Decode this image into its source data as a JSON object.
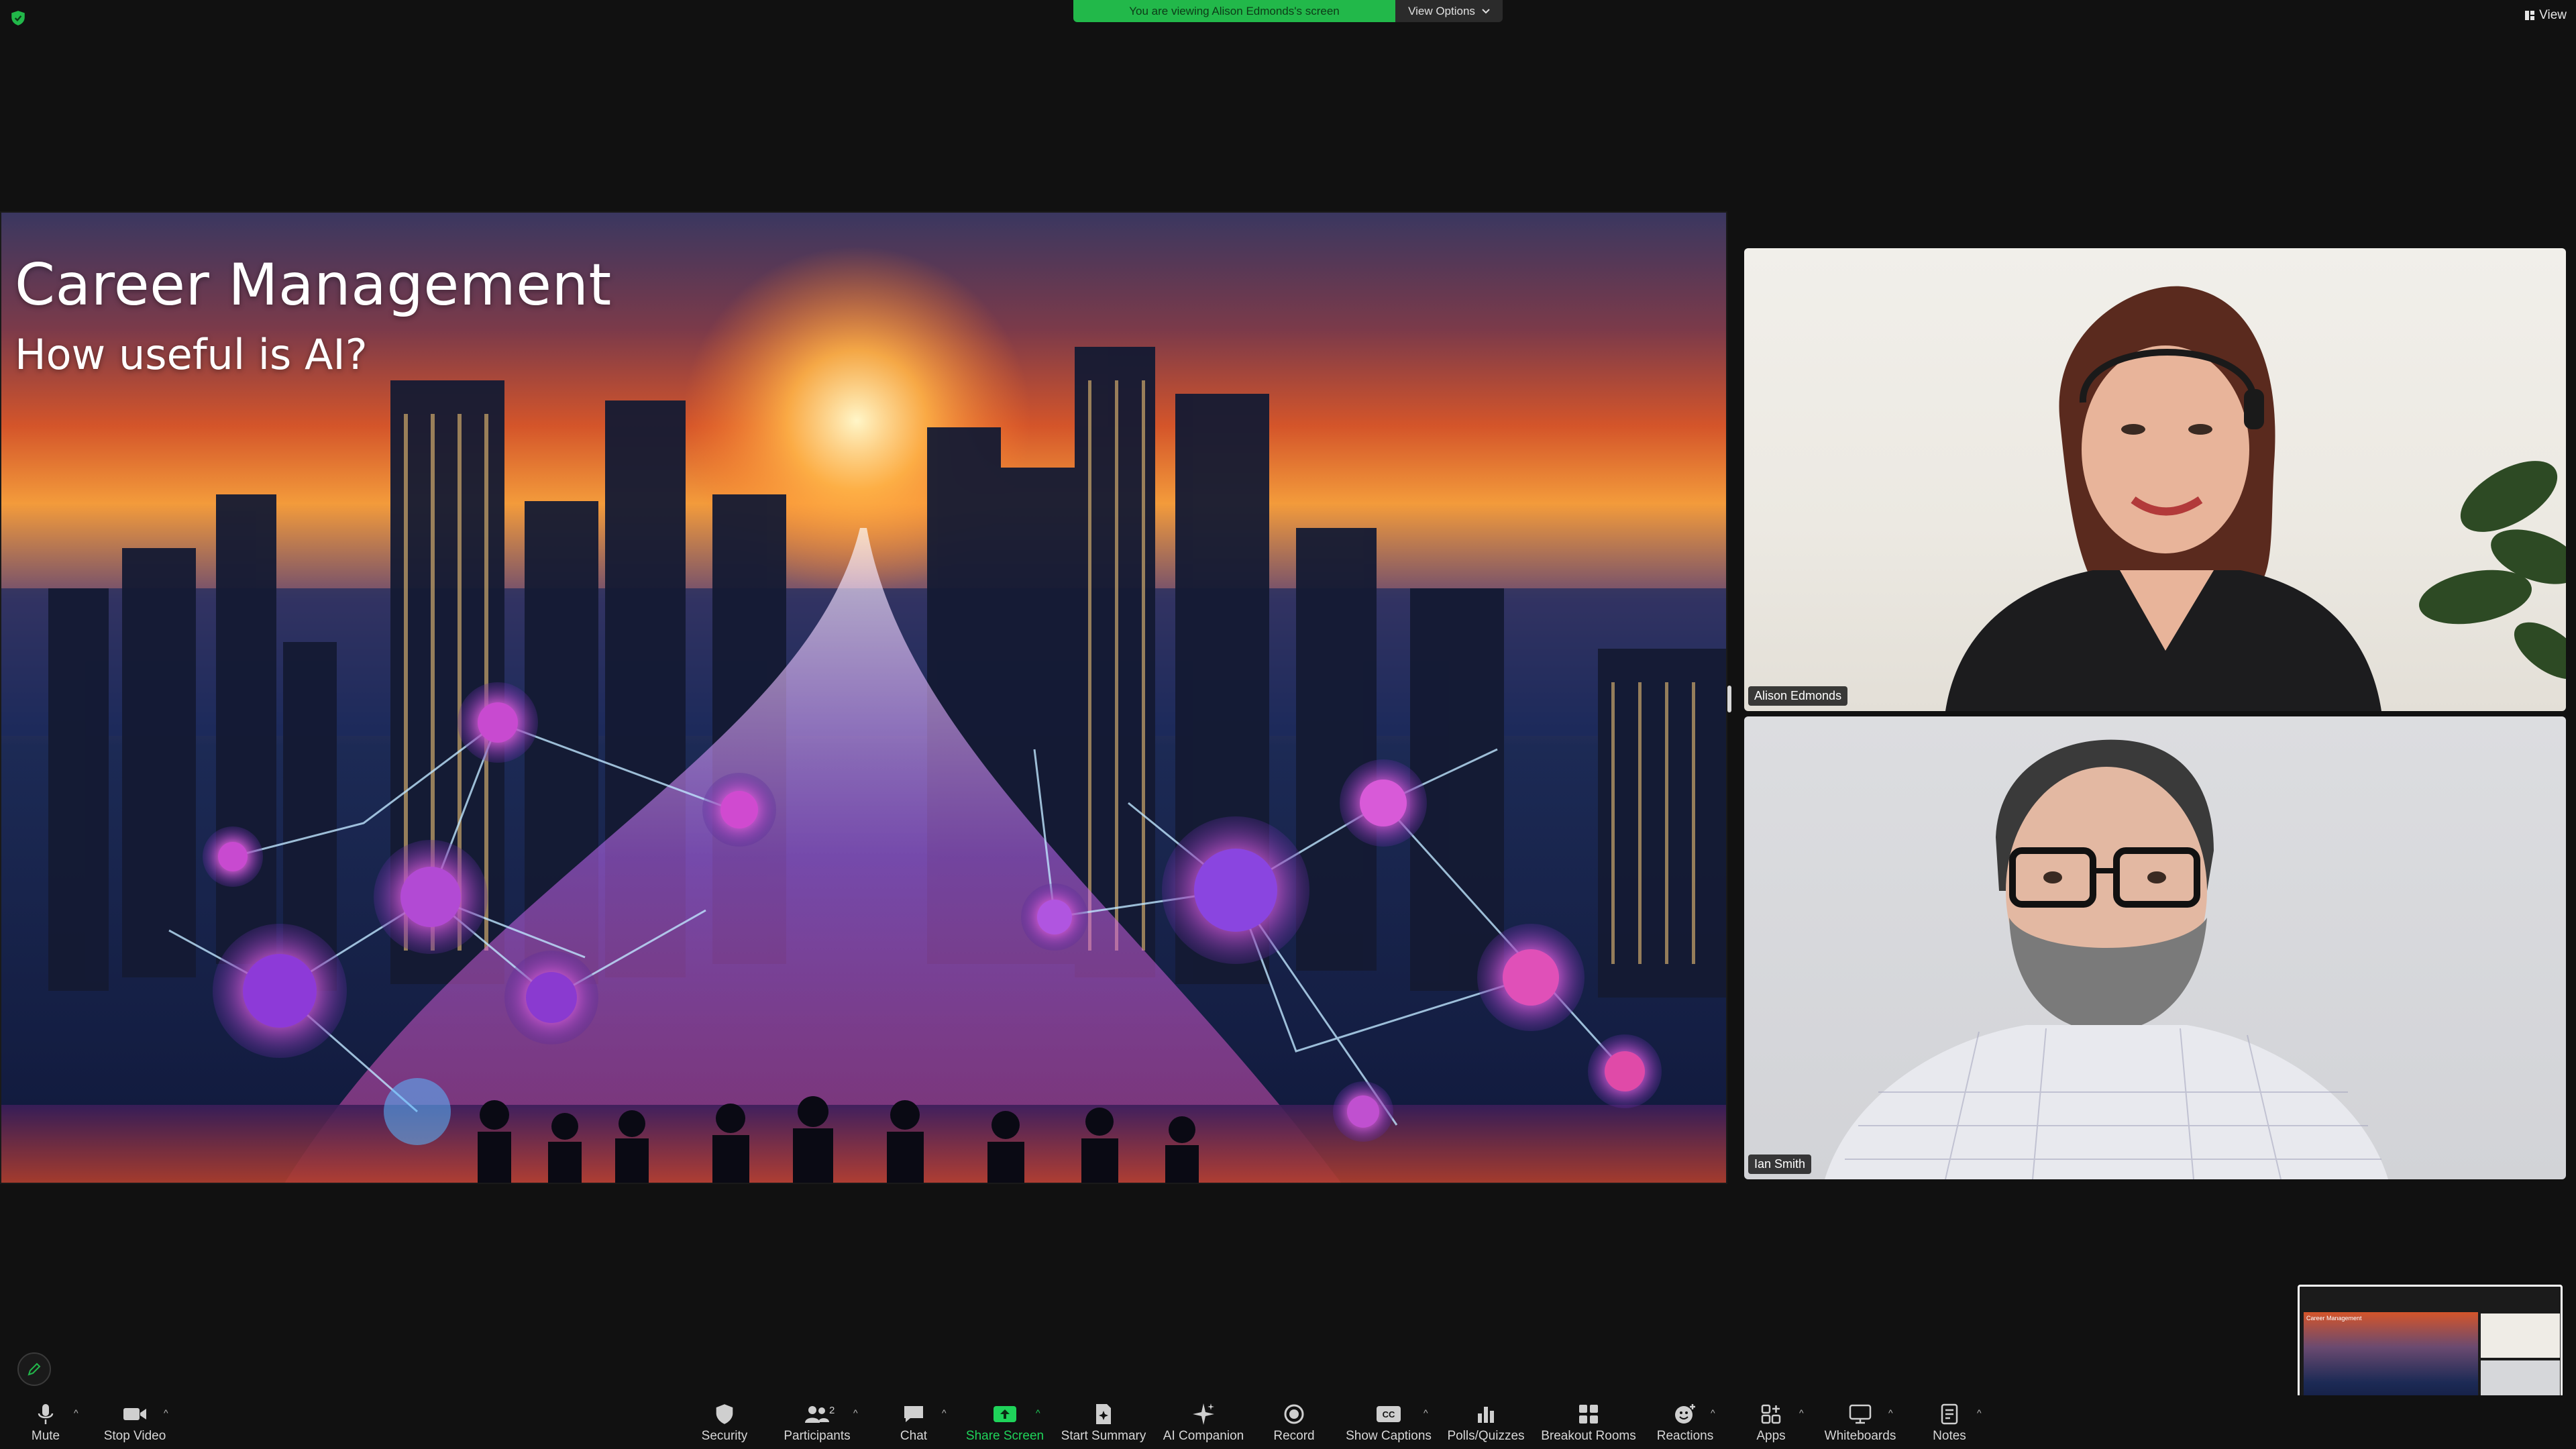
{
  "topbar": {
    "banner_text": "You are viewing Alison Edmonds's screen",
    "view_options": "View Options",
    "view": "View"
  },
  "slide": {
    "title": "Career Management",
    "subtitle": "How useful is AI?"
  },
  "participants": [
    {
      "name": "Alison Edmonds"
    },
    {
      "name": "Ian Smith"
    }
  ],
  "toolbar": {
    "mute": "Mute",
    "stop_video": "Stop Video",
    "security": "Security",
    "participants": "Participants",
    "participants_count": "2",
    "chat": "Chat",
    "share_screen": "Share Screen",
    "start_summary": "Start Summary",
    "ai_companion": "AI Companion",
    "record": "Record",
    "show_captions": "Show Captions",
    "polls": "Polls/Quizzes",
    "breakout": "Breakout Rooms",
    "reactions": "Reactions",
    "apps": "Apps",
    "whiteboards": "Whiteboards",
    "notes": "Notes"
  },
  "mini_preview": {
    "title": "Career Management"
  },
  "colors": {
    "banner_green": "#22b84a",
    "share_green": "#1fd35a",
    "toolbar_bg": "#111111"
  }
}
